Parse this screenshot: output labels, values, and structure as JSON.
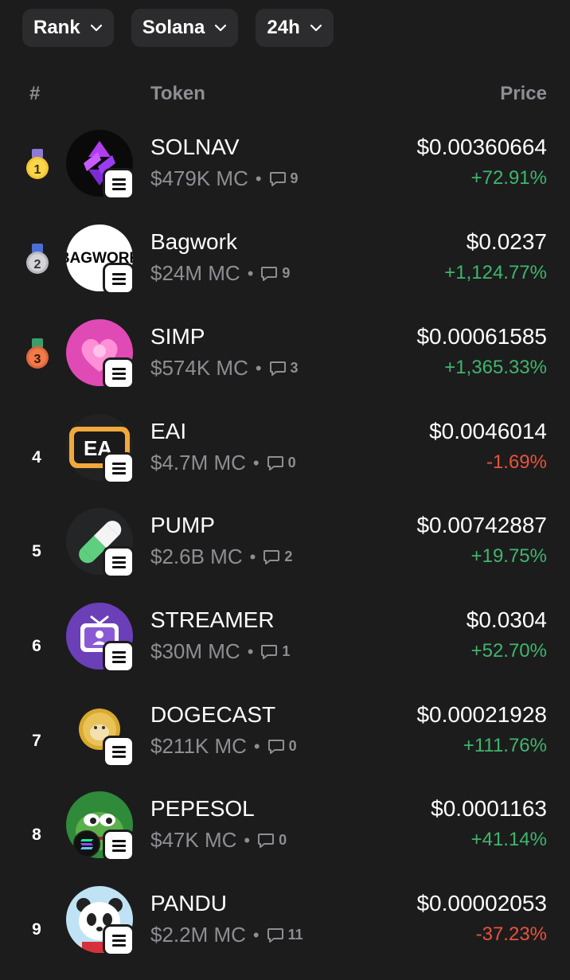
{
  "filters": [
    {
      "label": "Rank"
    },
    {
      "label": "Solana"
    },
    {
      "label": "24h"
    }
  ],
  "columns": {
    "rank": "#",
    "token": "Token",
    "price": "Price"
  },
  "tokens": [
    {
      "rank": "1",
      "name": "SOLNAV",
      "mc": "$479K MC",
      "comments": "9",
      "price": "$0.00360664",
      "change": "+72.91%",
      "direction": "up",
      "avatar": "solnav-logo",
      "medal": "gold-medal"
    },
    {
      "rank": "2",
      "name": "Bagwork",
      "mc": "$24M MC",
      "comments": "9",
      "price": "$0.0237",
      "change": "+1,124.77%",
      "direction": "up",
      "avatar": "bagwork-logo",
      "medal": "silver-medal",
      "avatar_text": "BAGWORK"
    },
    {
      "rank": "3",
      "name": "SIMP",
      "mc": "$574K MC",
      "comments": "3",
      "price": "$0.00061585",
      "change": "+1,365.33%",
      "direction": "up",
      "avatar": "simp-heart-logo",
      "medal": "bronze-medal"
    },
    {
      "rank": "4",
      "name": "EAI",
      "mc": "$4.7M MC",
      "comments": "0",
      "price": "$0.0046014",
      "change": "-1.69%",
      "direction": "down",
      "avatar": "eai-logo",
      "avatar_text": "EA"
    },
    {
      "rank": "5",
      "name": "PUMP",
      "mc": "$2.6B MC",
      "comments": "2",
      "price": "$0.00742887",
      "change": "+19.75%",
      "direction": "up",
      "avatar": "pill-logo"
    },
    {
      "rank": "6",
      "name": "STREAMER",
      "mc": "$30M MC",
      "comments": "1",
      "price": "$0.0304",
      "change": "+52.70%",
      "direction": "up",
      "avatar": "tv-streamer-logo"
    },
    {
      "rank": "7",
      "name": "DOGECAST",
      "mc": "$211K MC",
      "comments": "0",
      "price": "$0.00021928",
      "change": "+111.76%",
      "direction": "up",
      "avatar": "doge-coin-logo"
    },
    {
      "rank": "8",
      "name": "PEPESOL",
      "mc": "$47K MC",
      "comments": "0",
      "price": "$0.0001163",
      "change": "+41.14%",
      "direction": "up",
      "avatar": "pepe-frog-logo"
    },
    {
      "rank": "9",
      "name": "PANDU",
      "mc": "$2.2M MC",
      "comments": "11",
      "price": "$0.00002053",
      "change": "-37.23%",
      "direction": "down",
      "avatar": "panda-logo"
    }
  ],
  "colors": {
    "up": "#3fb66b",
    "down": "#e8533a",
    "background": "#1c1c1d",
    "chip": "#2c2c2e",
    "muted": "#8e8e93"
  }
}
